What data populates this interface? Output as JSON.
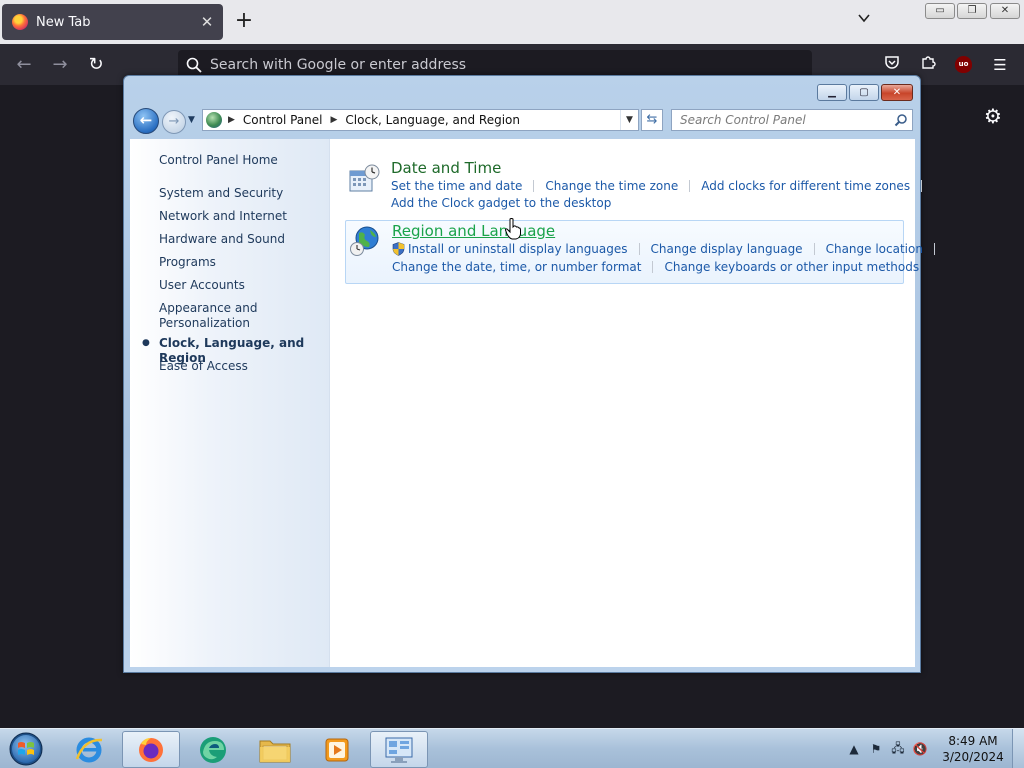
{
  "browser": {
    "tab_title": "New Tab",
    "tab_close": "✕",
    "new_tab": "+",
    "url_placeholder": "Search with Google or enter address"
  },
  "window": {
    "address": [
      "Control Panel",
      "Clock, Language, and Region"
    ],
    "search_placeholder": "Search Control Panel"
  },
  "sidebar": {
    "home": "Control Panel Home",
    "items": [
      "System and Security",
      "Network and Internet",
      "Hardware and Sound",
      "Programs",
      "User Accounts",
      "Appearance and",
      "Personalization",
      "Clock, Language, and Region",
      "Ease of Access"
    ]
  },
  "sections": [
    {
      "title": "Date and Time",
      "links_row1": [
        "Set the time and date",
        "Change the time zone",
        "Add clocks for different time zones"
      ],
      "links_row2": [
        "Add the Clock gadget to the desktop"
      ]
    },
    {
      "title": "Region and Language",
      "links_row1": [
        "Install or uninstall display languages",
        "Change display language",
        "Change location"
      ],
      "links_row2": [
        "Change the date, time, or number format",
        "Change keyboards or other input methods"
      ]
    }
  ],
  "taskbar": {
    "time": "8:49 AM",
    "date": "3/20/2024"
  },
  "colors": {
    "link_blue": "#1c59a8",
    "section_green": "#1e6a2a",
    "hover_green": "#1aa34a"
  }
}
